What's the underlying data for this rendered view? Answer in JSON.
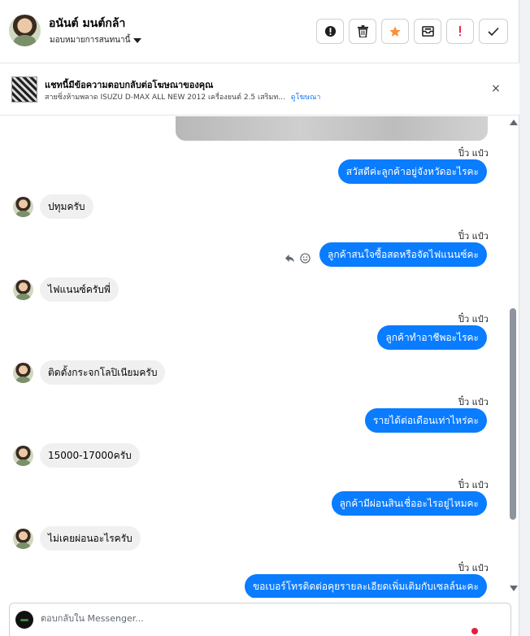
{
  "header": {
    "contact_name": "อนันต์ มนต์กล้า",
    "assign_label": "มอบหมายการสนทนานี้"
  },
  "ad_banner": {
    "title": "แชทนี้มีข้อความตอบกลับต่อโฆษณาของคุณ",
    "subtitle": "สายซิ่งห้ามพลาด ISUZU D-MAX ALL NEW 2012 เครื่องยนต์ 2.5 เสริมท...",
    "link": "ดูโฆษณา",
    "close": "×"
  },
  "messages": [
    {
      "sender": "ปิ๋ว แป๋ว",
      "text": "สวัสดีค่ะลูกค้าอยู่จังหวัดอะไรคะ"
    },
    {
      "text": "ปทุมครับ"
    },
    {
      "sender": "ปิ๋ว แป๋ว",
      "text": "ลูกค้าสนใจซื้อสดหรือจัดไฟแนนซ์คะ"
    },
    {
      "text": "ไฟแนนซ์ครับพี่"
    },
    {
      "sender": "ปิ๋ว แป๋ว",
      "text": "ลูกค้าทำอาชีพอะไรคะ"
    },
    {
      "text": "ติดตั้งกระจกโลปิเนียมครับ"
    },
    {
      "sender": "ปิ๋ว แป๋ว",
      "text": "รายได้ต่อเดือนเท่าไหร่คะ"
    },
    {
      "text": "15000-17000ครับ"
    },
    {
      "sender": "ปิ๋ว แป๋ว",
      "text": "ลูกค้ามีผ่อนสินเชื่ออะไรอยู่ไหมคะ"
    },
    {
      "text": "ไม่เคยผ่อนอะไรครับ"
    },
    {
      "sender": "ปิ๋ว แป๋ว",
      "text": "ขอเบอร์โทรติดต่อคุยรายละเอียดเพิ่มเติมกับเซลล์นะคะ"
    }
  ],
  "composer": {
    "placeholder": "ตอบกลับใน Messenger..."
  },
  "colors": {
    "outgoing_bubble": "#0a7cff",
    "incoming_bubble": "#f0f0f0",
    "star": "#f7923b",
    "alert": "#e41e3f"
  },
  "icons": {
    "actions": [
      "alert-circle-icon",
      "trash-icon",
      "star-icon",
      "archive-icon",
      "exclamation-icon",
      "check-icon"
    ]
  }
}
